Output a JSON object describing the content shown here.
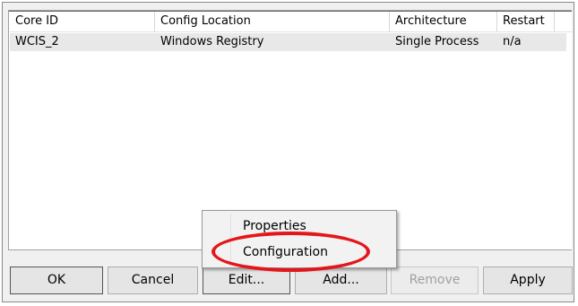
{
  "table": {
    "columns": [
      "Core ID",
      "Config Location",
      "Architecture",
      "Restart"
    ],
    "rows": [
      [
        "WCIS_2",
        "Windows Registry",
        "Single Process",
        "n/a"
      ]
    ]
  },
  "buttons": {
    "ok": "OK",
    "cancel": "Cancel",
    "edit": "Edit...",
    "add": "Add...",
    "remove": "Remove",
    "apply": "Apply"
  },
  "context_menu": {
    "items": [
      "Properties",
      "Configuration"
    ],
    "highlighted": "Configuration"
  },
  "colors": {
    "highlight_ellipse": "#e3161b",
    "selected_row": "#e8e8e8"
  }
}
